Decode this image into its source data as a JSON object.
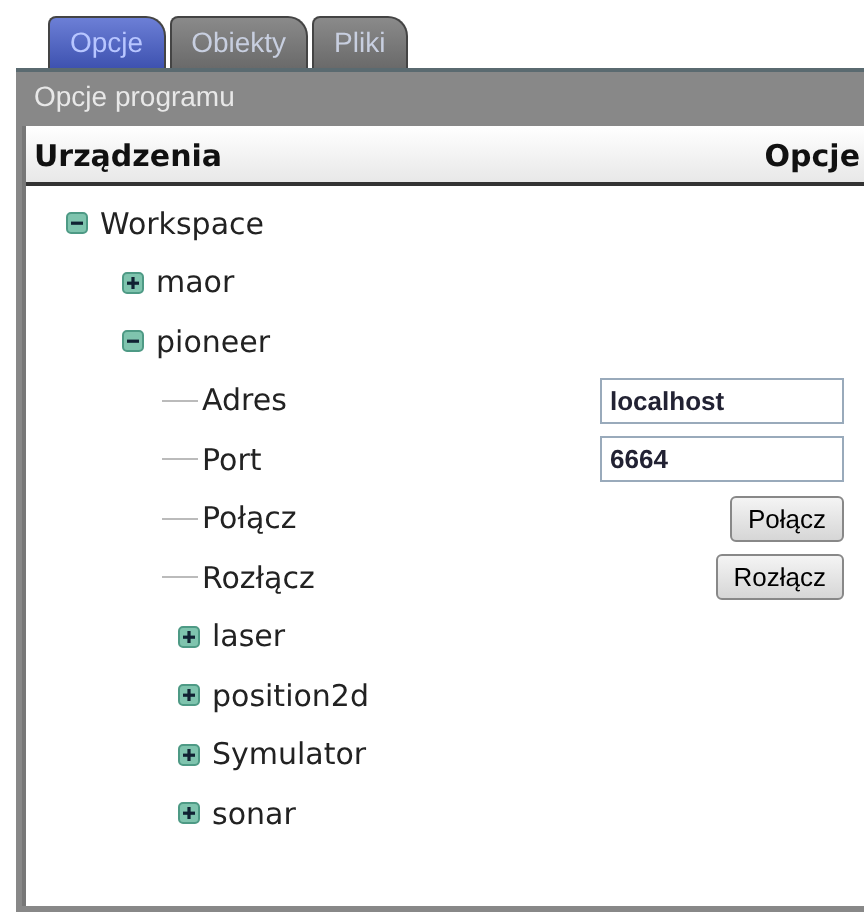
{
  "tabs": [
    {
      "label": "Opcje",
      "selected": true
    },
    {
      "label": "Obiekty",
      "selected": false
    },
    {
      "label": "Pliki",
      "selected": false
    }
  ],
  "panel": {
    "title": "Opcje programu",
    "columns": [
      "Urządzenia",
      "Opcje"
    ]
  },
  "tree": [
    {
      "label": "Workspace",
      "kind": "node",
      "expanded": true,
      "children": [
        {
          "label": "maor",
          "kind": "node",
          "expanded": false
        },
        {
          "label": "pioneer",
          "kind": "node",
          "expanded": true,
          "children": [
            {
              "label": "Adres",
              "kind": "field",
              "value": "localhost"
            },
            {
              "label": "Port",
              "kind": "field",
              "value": "6664"
            },
            {
              "label": "Połącz",
              "kind": "button",
              "button": "Połącz"
            },
            {
              "label": "Rozłącz",
              "kind": "button",
              "button": "Rozłącz"
            },
            {
              "label": "laser",
              "kind": "node",
              "expanded": false
            },
            {
              "label": "position2d",
              "kind": "node",
              "expanded": false
            },
            {
              "label": "Symulator",
              "kind": "node",
              "expanded": false
            },
            {
              "label": "sonar",
              "kind": "node",
              "expanded": false
            }
          ]
        }
      ]
    }
  ]
}
